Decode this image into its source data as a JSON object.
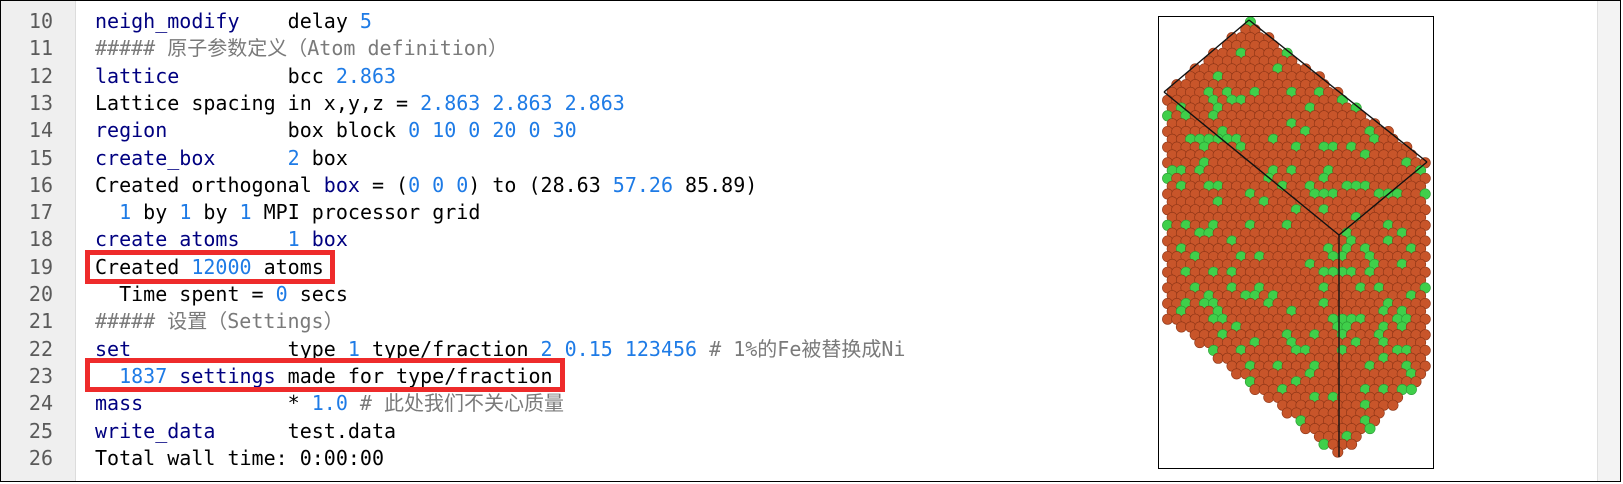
{
  "editor": {
    "lines": [
      {
        "n": "10",
        "segs": [
          {
            "t": "neigh_modify",
            "c": "kw"
          },
          {
            "t": "    delay ",
            "c": ""
          },
          {
            "t": "5",
            "c": "num"
          }
        ]
      },
      {
        "n": "11",
        "segs": [
          {
            "t": "##### 原子参数定义（Atom definition）",
            "c": "cm"
          }
        ]
      },
      {
        "n": "12",
        "segs": [
          {
            "t": "lattice",
            "c": "kw"
          },
          {
            "t": "         bcc ",
            "c": ""
          },
          {
            "t": "2.863",
            "c": "num"
          }
        ]
      },
      {
        "n": "13",
        "segs": [
          {
            "t": "Lattice spacing in x,y,z = ",
            "c": ""
          },
          {
            "t": "2.863 2.863 2.863",
            "c": "num"
          }
        ]
      },
      {
        "n": "14",
        "segs": [
          {
            "t": "region",
            "c": "kw"
          },
          {
            "t": "          box block ",
            "c": ""
          },
          {
            "t": "0 10 0 20 0 30",
            "c": "num"
          }
        ]
      },
      {
        "n": "15",
        "segs": [
          {
            "t": "create_box",
            "c": "kw"
          },
          {
            "t": "      ",
            "c": ""
          },
          {
            "t": "2",
            "c": "num"
          },
          {
            "t": " box",
            "c": ""
          }
        ]
      },
      {
        "n": "16",
        "segs": [
          {
            "t": "Created orthogonal ",
            "c": ""
          },
          {
            "t": "box",
            "c": "kw"
          },
          {
            "t": " = (",
            "c": ""
          },
          {
            "t": "0 0 0",
            "c": "num"
          },
          {
            "t": ") to (",
            "c": ""
          },
          {
            "t": "28.63",
            "c": ""
          },
          {
            "t": " 57.26",
            "c": "num"
          },
          {
            "t": " 85.89",
            "c": ""
          },
          {
            "t": ")",
            "c": ""
          }
        ]
      },
      {
        "n": "17",
        "segs": [
          {
            "t": "  ",
            "c": ""
          },
          {
            "t": "1",
            "c": "num"
          },
          {
            "t": " by ",
            "c": ""
          },
          {
            "t": "1",
            "c": "num"
          },
          {
            "t": " by ",
            "c": ""
          },
          {
            "t": "1",
            "c": "num"
          },
          {
            "t": " MPI processor grid",
            "c": ""
          }
        ]
      },
      {
        "n": "18",
        "segs": [
          {
            "t": "create_atoms",
            "c": "kw"
          },
          {
            "t": "    ",
            "c": ""
          },
          {
            "t": "1",
            "c": "num"
          },
          {
            "t": " box",
            "c": "kw"
          }
        ]
      },
      {
        "n": "19",
        "segs": [
          {
            "t": "Created ",
            "c": ""
          },
          {
            "t": "12000",
            "c": "num"
          },
          {
            "t": " atoms",
            "c": ""
          }
        ]
      },
      {
        "n": "20",
        "segs": [
          {
            "t": "  Time spent = ",
            "c": ""
          },
          {
            "t": "0",
            "c": "num"
          },
          {
            "t": " secs",
            "c": ""
          }
        ]
      },
      {
        "n": "21",
        "segs": [
          {
            "t": "##### 设置（Settings）",
            "c": "cm"
          }
        ]
      },
      {
        "n": "22",
        "segs": [
          {
            "t": "set",
            "c": "kw"
          },
          {
            "t": "             type ",
            "c": ""
          },
          {
            "t": "1",
            "c": "num"
          },
          {
            "t": " type/fraction ",
            "c": ""
          },
          {
            "t": "2 0.15 123456",
            "c": "num"
          },
          {
            "t": " # 1%的Fe被替换成Ni",
            "c": "cm"
          }
        ]
      },
      {
        "n": "23",
        "segs": [
          {
            "t": "  ",
            "c": ""
          },
          {
            "t": "1837",
            "c": "num"
          },
          {
            "t": " settings",
            "c": "kw"
          },
          {
            "t": " made for type/fraction",
            "c": ""
          }
        ]
      },
      {
        "n": "24",
        "segs": [
          {
            "t": "mass",
            "c": "kw"
          },
          {
            "t": "            * ",
            "c": ""
          },
          {
            "t": "1.0",
            "c": "num"
          },
          {
            "t": " # 此处我们不关心质量",
            "c": "cm"
          }
        ]
      },
      {
        "n": "25",
        "segs": [
          {
            "t": "write_data",
            "c": "kw"
          },
          {
            "t": "      test.data",
            "c": ""
          }
        ]
      },
      {
        "n": "26",
        "segs": [
          {
            "t": "Total wall time: 0:00:00",
            "c": ""
          }
        ]
      }
    ]
  },
  "colors": {
    "keyword": "#000080",
    "number": "#1e7be6",
    "comment": "#7a7a7a",
    "highlight": "#ee2b2b",
    "atom_fe": "#c8552a",
    "atom_ni": "#3fcf4a"
  },
  "visualization": {
    "description_icon": "atom-lattice-render",
    "type1_color": "#c8552a",
    "type2_color": "#3fcf4a",
    "type2_fraction": 0.15
  }
}
